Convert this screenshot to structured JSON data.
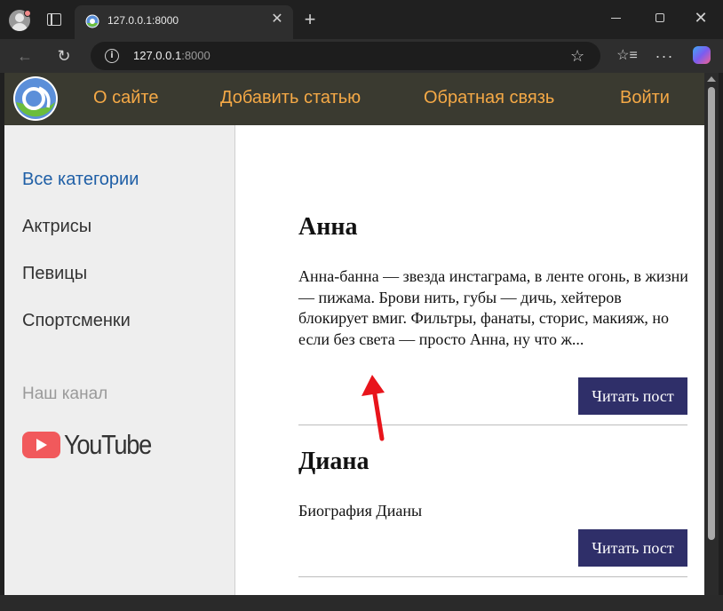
{
  "browser": {
    "tab_title": "127.0.0.1:8000",
    "url_host": "127.0.0.1",
    "url_port": ":8000",
    "icons": [
      "profile-icon",
      "tab-actions-icon",
      "favicon",
      "close-icon",
      "plus-icon",
      "minimize-icon",
      "maximize-icon",
      "close-icon",
      "back-icon",
      "reload-icon",
      "info-icon",
      "star-icon",
      "favorites-icon",
      "more-icon",
      "copilot-icon"
    ]
  },
  "site": {
    "nav": {
      "about": "О сайте",
      "add_article": "Добавить статью",
      "feedback": "Обратная связь",
      "login": "Войти"
    },
    "sidebar": {
      "categories": [
        "Все категории",
        "Актрисы",
        "Певицы",
        "Спортсменки"
      ],
      "channel_label": "Наш канал",
      "youtube": "YouTube"
    },
    "posts": [
      {
        "title": "Анна",
        "text": "Анна-банна — звезда инстаграма, в ленте огонь, в жизни — пижама. Брови нить, губы — дичь, хейтеров блокирует вмиг. Фильтры, фанаты, сторис, макияж, но если без света — просто Анна, ну что ж...",
        "button": "Читать пост"
      },
      {
        "title": "Диана",
        "text": "Биография Дианы",
        "button": "Читать пост"
      }
    ]
  },
  "colors": {
    "header_bg": "#3a3a30",
    "nav_link": "#f5a946",
    "active_category": "#1f5fa6",
    "button_bg": "#2f2f69",
    "annotation_arrow": "#e8141b"
  }
}
